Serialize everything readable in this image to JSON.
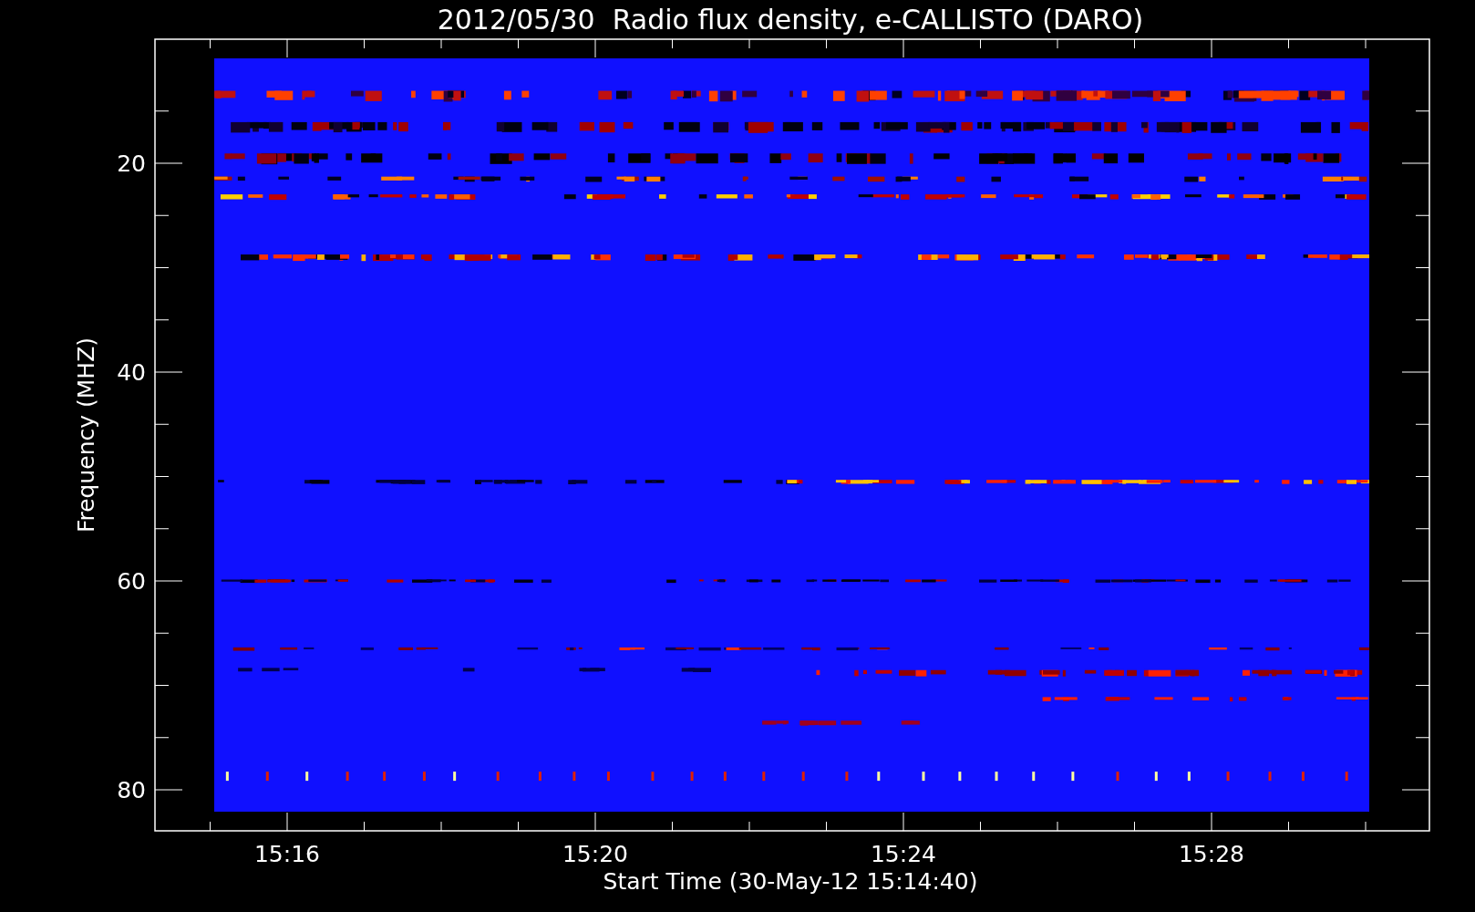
{
  "title": "2012/05/30  Radio flux density, e-CALLISTO (DARO)",
  "ylabel": "Frequency (MHZ)",
  "xlabel": "Start Time (30-May-12 15:14:40)",
  "yticks": [
    "20",
    "40",
    "60",
    "80"
  ],
  "xticks": [
    "15:16",
    "15:20",
    "15:24",
    "15:28"
  ]
}
